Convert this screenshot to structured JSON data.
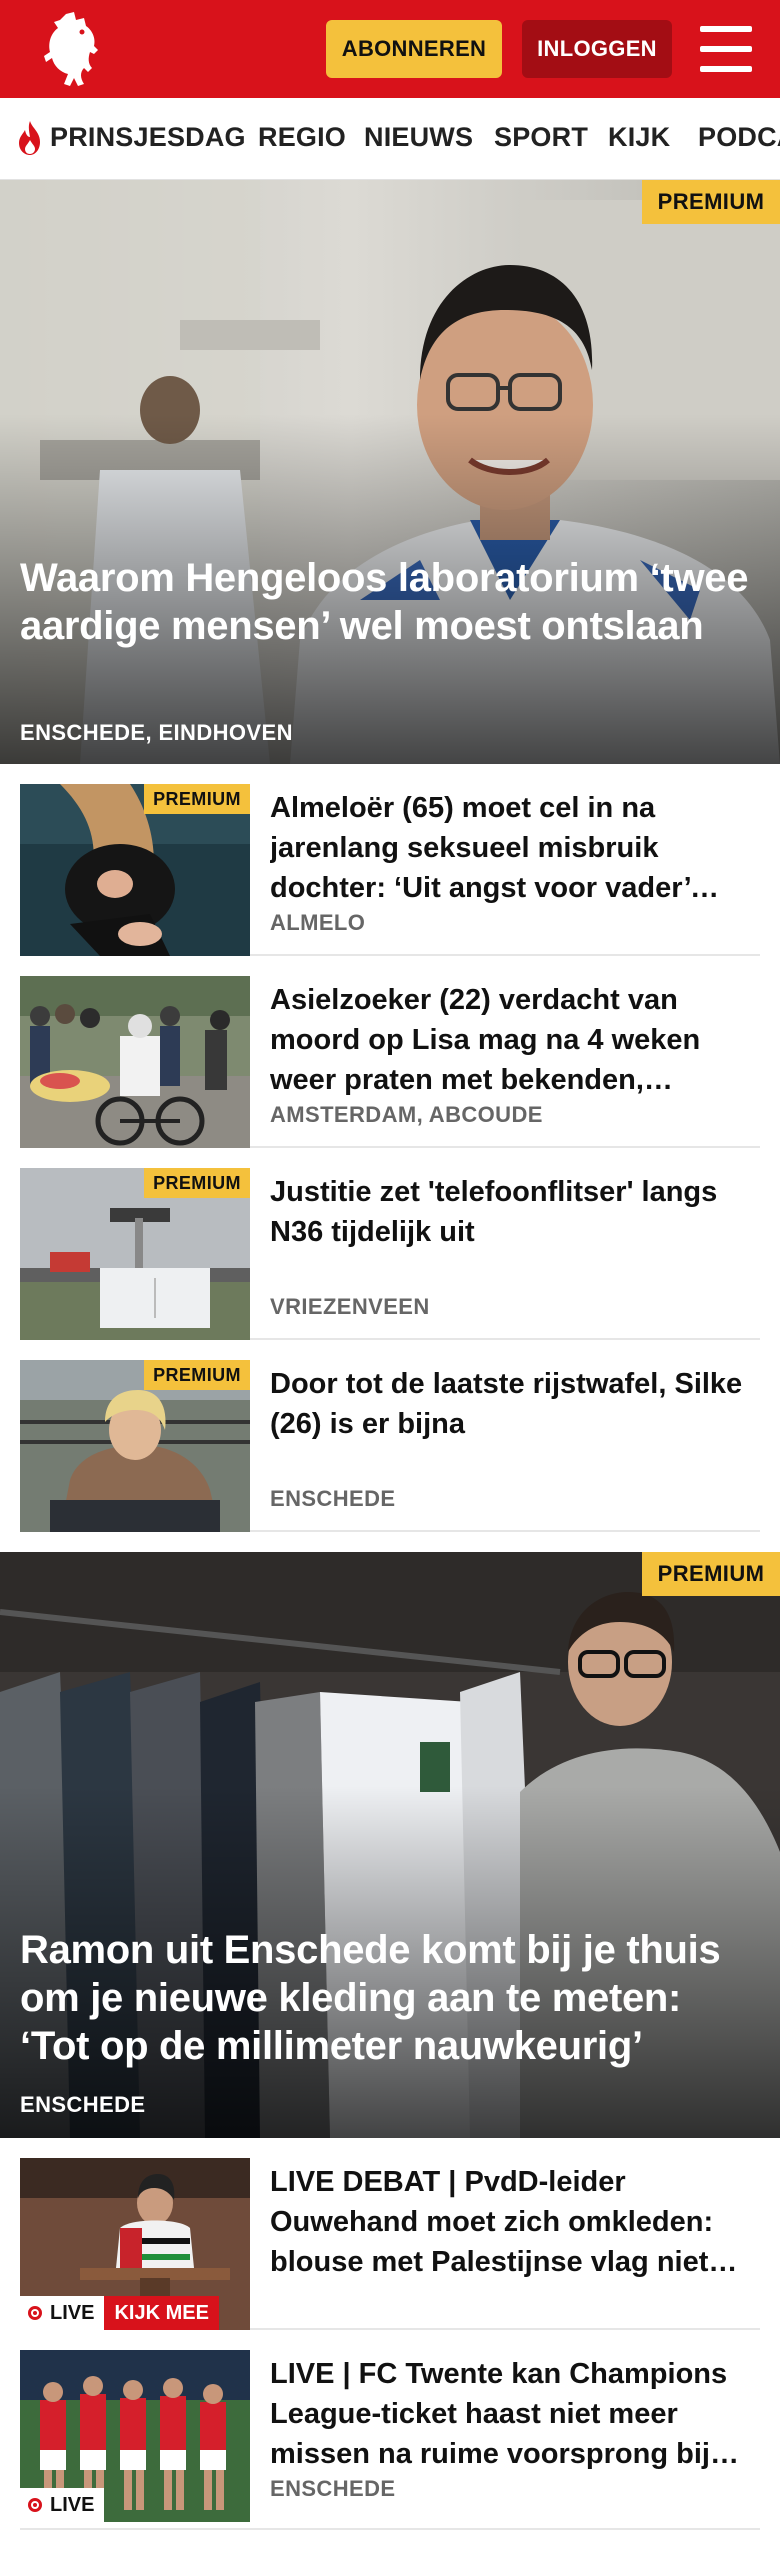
{
  "header": {
    "logo_icon": "horse-logo-icon",
    "subscribe_label": "ABONNEREN",
    "login_label": "INLOGGEN",
    "menu_icon": "hamburger-menu-icon",
    "brand_color": "#d8121b",
    "subscribe_color": "#f4c13c"
  },
  "nav": {
    "items": [
      {
        "label": "PRINSJESDAG",
        "icon": "flame-icon"
      },
      {
        "label": "REGIO"
      },
      {
        "label": "NIEUWS"
      },
      {
        "label": "SPORT"
      },
      {
        "label": "KIJK"
      },
      {
        "label": "PODCA"
      }
    ]
  },
  "hero1": {
    "badge": "PREMIUM",
    "title": "Waarom Hengeloos laboratorium ‘twee aardige mensen’ wel moest ontslaan",
    "location": "ENSCHEDE, EINDHOVEN"
  },
  "articles1": [
    {
      "badge": "PREMIUM",
      "title": "Almeloër (65) moet cel in na jarenlang seksueel misbruik dochter: ‘Uit angst voor vader’ zweeg ze",
      "location": "ALMELO"
    },
    {
      "badge": "",
      "title": "Asielzoeker (22) verdacht van moord op Lisa mag na 4 weken weer praten met bekenden, behalve met advocaat",
      "location": "AMSTERDAM, ABCOUDE"
    },
    {
      "badge": "PREMIUM",
      "title": "Justitie zet 'telefoonflitser' langs N36 tijdelijk uit",
      "location": "VRIEZENVEEN"
    },
    {
      "badge": "PREMIUM",
      "title": "Door tot de laatste rijstwafel, Silke (26) is er bijna",
      "location": "ENSCHEDE"
    }
  ],
  "hero2": {
    "badge": "PREMIUM",
    "title": "Ramon uit Enschede komt bij je thuis om je nieuwe kleding aan te meten: ‘Tot op de millimeter nauwkeurig’",
    "location": "ENSCHEDE"
  },
  "articles2": [
    {
      "live_label": "LIVE",
      "watch_label": "KIJK MEE",
      "title": "LIVE DEBAT | PvdD-leider Ouwehand moet zich omkleden: blouse met Palestijnse vlag niet toegestaan",
      "location": ""
    },
    {
      "live_label": "LIVE",
      "watch_label": "",
      "title": "LIVE | FC Twente kan Champions League-ticket haast niet meer missen na ruime voorsprong bij Sparta",
      "location": "ENSCHEDE"
    }
  ]
}
